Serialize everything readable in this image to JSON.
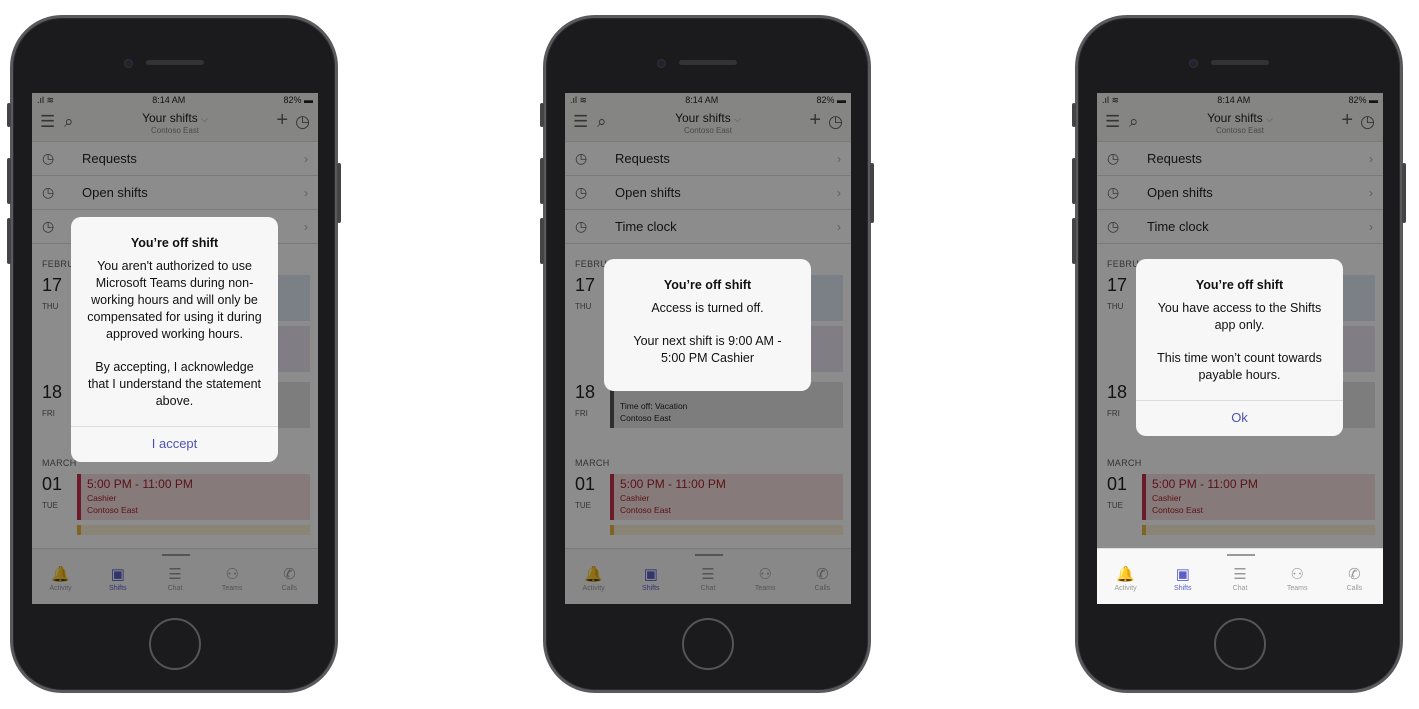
{
  "status": {
    "time": "8:14 AM",
    "battery": "82%",
    "signal": "signal-wifi-icons"
  },
  "header": {
    "title": "Your shifts",
    "subtitle": "Contoso East"
  },
  "menu": [
    {
      "label": "Requests",
      "icon": "clock-question-icon"
    },
    {
      "label": "Open shifts",
      "icon": "clock-brackets-icon"
    },
    {
      "label": "Time clock",
      "icon": "stopwatch-icon"
    }
  ],
  "schedule": {
    "feb": "FEBRUARY",
    "mar": "MARCH",
    "d17": {
      "num": "17",
      "dow": "THU"
    },
    "d18": {
      "num": "18",
      "dow": "FRI",
      "title": "Time off: Vacation",
      "loc": "Contoso East"
    },
    "d01": {
      "num": "01",
      "dow": "TUE",
      "time": "5:00 PM - 11:00 PM",
      "role": "Cashier",
      "loc": "Contoso East"
    }
  },
  "tabs": [
    {
      "label": "Activity"
    },
    {
      "label": "Shifts"
    },
    {
      "label": "Chat"
    },
    {
      "label": "Teams"
    },
    {
      "label": "Calls"
    }
  ],
  "dialogs": [
    {
      "title": "You’re off shift",
      "paragraphs": [
        "You aren't authorized to use Microsoft Teams during non-working hours and will only be compensated for using it during approved working hours.",
        "By accepting, I acknowledge that I understand the statement above."
      ],
      "action": "I accept"
    },
    {
      "title": "You’re off shift",
      "paragraphs": [
        "Access is turned off.",
        "Your next shift is 9:00 AM - 5:00 PM Cashier"
      ],
      "action": ""
    },
    {
      "title": "You’re off shift",
      "paragraphs": [
        "You have access to the Shifts app only.",
        "This time won’t count towards payable hours."
      ],
      "action": "Ok"
    }
  ],
  "colors": {
    "accent": "#5b5fc7",
    "shift_red": "#c4314b"
  }
}
